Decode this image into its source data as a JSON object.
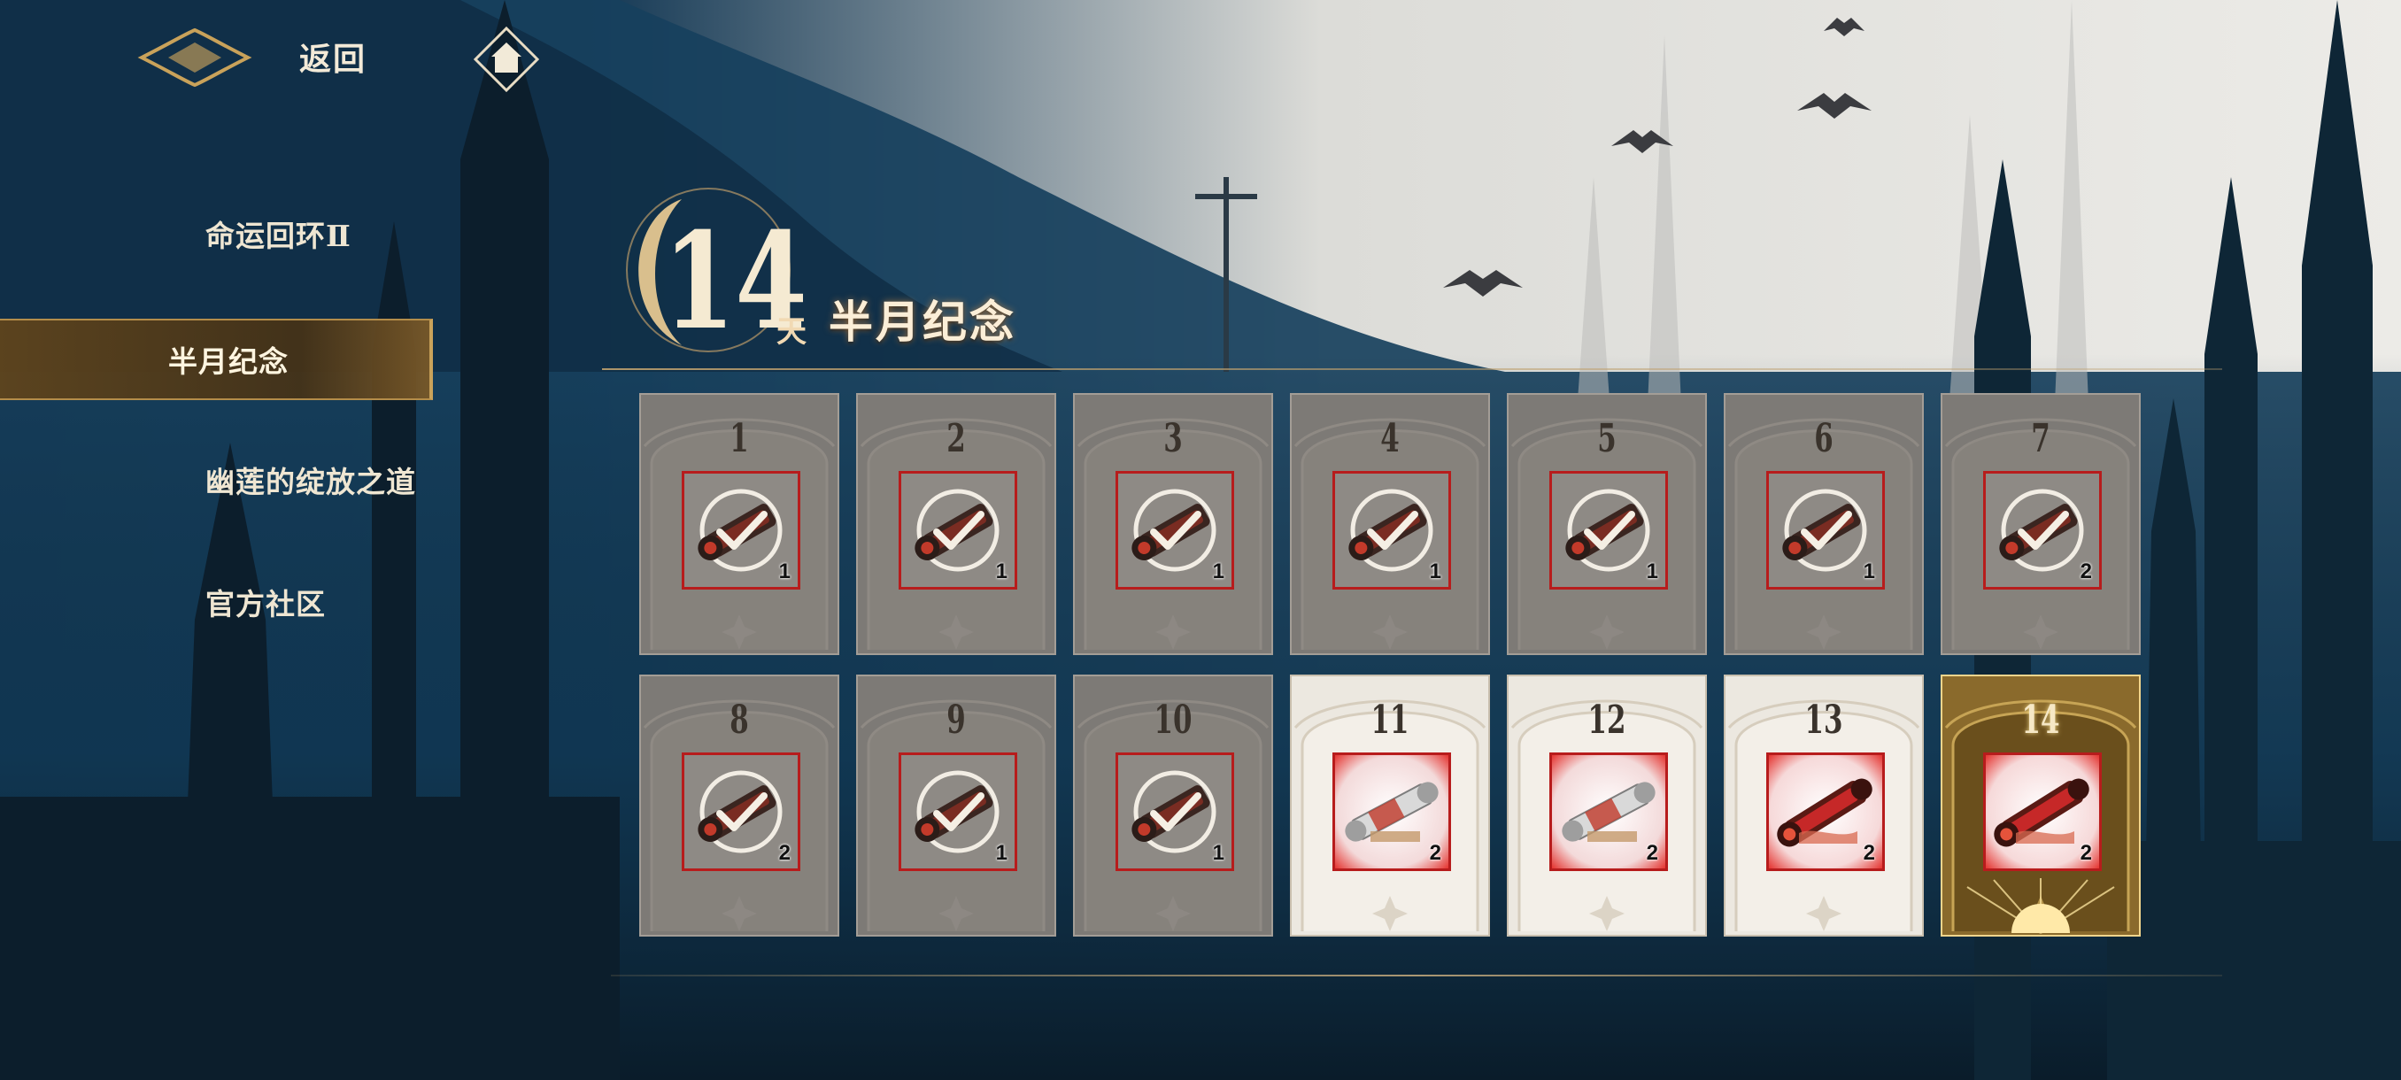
{
  "topbar": {
    "back_label": "返回"
  },
  "sidebar": {
    "items": [
      {
        "label": "命运回环Ⅱ",
        "active": false
      },
      {
        "label": "半月纪念",
        "active": true
      },
      {
        "label": "幽莲的绽放之道",
        "active": false
      },
      {
        "label": "官方社区",
        "active": false
      }
    ]
  },
  "header": {
    "days_number": "14",
    "days_unit": "天",
    "title": "半月纪念"
  },
  "rewards": [
    {
      "day": "1",
      "qty": "1",
      "status": "claimed",
      "item": "scroll-icon"
    },
    {
      "day": "2",
      "qty": "1",
      "status": "claimed",
      "item": "scroll-icon"
    },
    {
      "day": "3",
      "qty": "1",
      "status": "claimed",
      "item": "scroll-icon"
    },
    {
      "day": "4",
      "qty": "1",
      "status": "claimed",
      "item": "scroll-icon"
    },
    {
      "day": "5",
      "qty": "1",
      "status": "claimed",
      "item": "scroll-icon"
    },
    {
      "day": "6",
      "qty": "1",
      "status": "claimed",
      "item": "scroll-icon"
    },
    {
      "day": "7",
      "qty": "2",
      "status": "claimed",
      "item": "scroll-icon"
    },
    {
      "day": "8",
      "qty": "2",
      "status": "claimed",
      "item": "scroll-icon"
    },
    {
      "day": "9",
      "qty": "1",
      "status": "claimed",
      "item": "scroll-icon"
    },
    {
      "day": "10",
      "qty": "1",
      "status": "claimed",
      "item": "scroll-icon"
    },
    {
      "day": "11",
      "qty": "2",
      "status": "locked",
      "item": "silver-scroll-icon"
    },
    {
      "day": "12",
      "qty": "2",
      "status": "locked",
      "item": "silver-scroll-icon"
    },
    {
      "day": "13",
      "qty": "2",
      "status": "locked",
      "item": "red-scroll-icon"
    },
    {
      "day": "14",
      "qty": "2",
      "status": "special",
      "item": "red-scroll-icon"
    }
  ],
  "colors": {
    "claimed_bg": "#7d7a76",
    "locked_bg": "#ece8e0",
    "special_bg": "#8a6a2c",
    "item_border": "#b71c1c",
    "accent_gold": "#c9a25a"
  }
}
